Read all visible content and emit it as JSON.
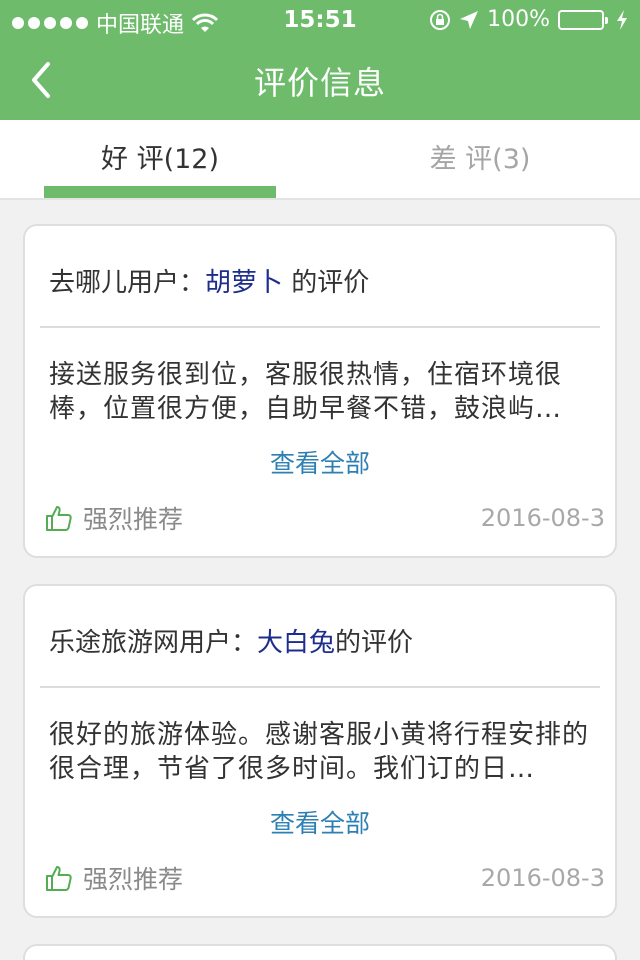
{
  "status_bar": {
    "carrier": "中国联通",
    "time": "15:51",
    "battery_percent": "100%",
    "icons": [
      "signal-dots-icon",
      "wifi-icon",
      "orientation-lock-icon",
      "location-icon",
      "battery-icon",
      "charging-icon"
    ]
  },
  "nav": {
    "title": "评价信息",
    "back_icon": "chevron-left-icon"
  },
  "tabs": [
    {
      "label": "好 评(12)",
      "active": true
    },
    {
      "label": "差 评(3)",
      "active": false
    }
  ],
  "colors": {
    "brand_green": "#6dbb6b",
    "username_blue": "#1d2d8b",
    "link_blue": "#2e7fb3",
    "muted_gray": "#a5a5a5"
  },
  "reviews": [
    {
      "source": "去哪儿用户：",
      "username": "胡萝卜",
      "suffix": " 的评价",
      "text": "接送服务很到位，客服很热情，住宿环境很棒，位置很方便，自助早餐不错，鼓浪屿…",
      "more_label": "查看全部",
      "recommend_label": "强烈推荐",
      "date": "2016-08-3"
    },
    {
      "source": "乐途旅游网用户：",
      "username": "大白兔",
      "suffix": "的评价",
      "text": "很好的旅游体验。感谢客服小黄将行程安排的很合理，节省了很多时间。我们订的日…",
      "more_label": "查看全部",
      "recommend_label": "强烈推荐",
      "date": "2016-08-3"
    }
  ]
}
